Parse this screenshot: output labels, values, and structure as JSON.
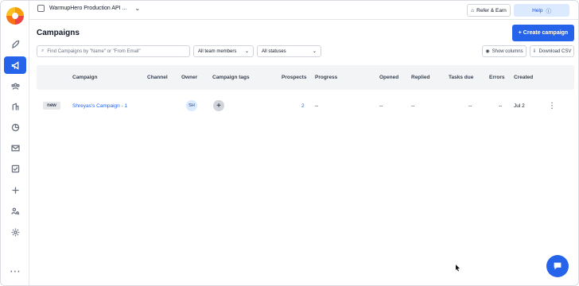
{
  "topbar": {
    "workspace": "WarmupHero Production API ...",
    "refer": "Refer & Earn",
    "help": "Help"
  },
  "page": {
    "title": "Campaigns",
    "create": "+ Create campaign"
  },
  "filters": {
    "search_placeholder": "Find Campaigns by \"Name\" or \"From Email\"",
    "team": "All team members",
    "status": "All statuses",
    "show_columns": "Show columns",
    "download": "Download CSV"
  },
  "table": {
    "headers": [
      "Campaign",
      "Channel",
      "Owner",
      "Campaign tags",
      "Prospects",
      "Progress",
      "Opened",
      "Replied",
      "Tasks due",
      "Errors",
      "Created"
    ],
    "rows": [
      {
        "status": "new",
        "campaign": "Shreyas's Campaign - 1",
        "owner": "SH",
        "prospects": "2",
        "progress": "--",
        "opened": "--",
        "replied": "--",
        "tasks_due": "--",
        "errors": "--",
        "created": "Jul 2"
      }
    ]
  }
}
